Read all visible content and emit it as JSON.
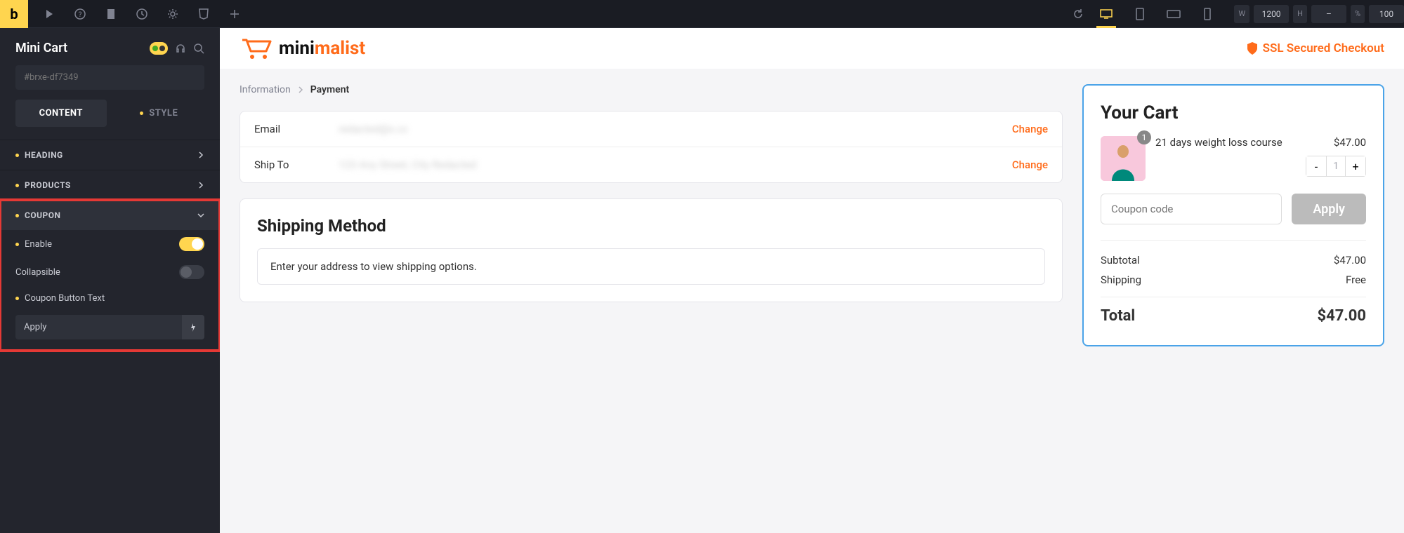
{
  "toolbar": {
    "dims": {
      "w_label": "W",
      "w_val": "1200",
      "h_label": "H",
      "h_val": "–",
      "pct_label": "%",
      "pct_val": "100"
    }
  },
  "sidebar": {
    "title": "Mini Cart",
    "id_placeholder": "#brxe-df7349",
    "tabs": {
      "content": "CONTENT",
      "style": "STYLE"
    },
    "sections": {
      "heading": "HEADING",
      "products": "PRODUCTS",
      "coupon": "COUPON"
    },
    "coupon_controls": {
      "enable": "Enable",
      "collapsible": "Collapsible",
      "button_text_label": "Coupon Button Text",
      "button_text_value": "Apply"
    }
  },
  "page": {
    "brand": {
      "part1": "mini",
      "part2": "malist"
    },
    "ssl": "SSL Secured Checkout",
    "breadcrumb": {
      "step1": "Information",
      "step2": "Payment"
    },
    "info": {
      "email_label": "Email",
      "email_value": "redacted@x.cc",
      "ship_label": "Ship To",
      "ship_value": "123 Any Street, City Redacted",
      "change": "Change"
    },
    "shipping": {
      "title": "Shipping Method",
      "message": "Enter your address to view shipping options."
    },
    "cart": {
      "title": "Your Cart",
      "item": {
        "name": "21 days weight loss course",
        "price": "$47.00",
        "qty": "1",
        "badge": "1"
      },
      "coupon_placeholder": "Coupon code",
      "coupon_btn": "Apply",
      "subtotal_label": "Subtotal",
      "subtotal_val": "$47.00",
      "shipping_label": "Shipping",
      "shipping_val": "Free",
      "total_label": "Total",
      "total_val": "$47.00"
    }
  }
}
